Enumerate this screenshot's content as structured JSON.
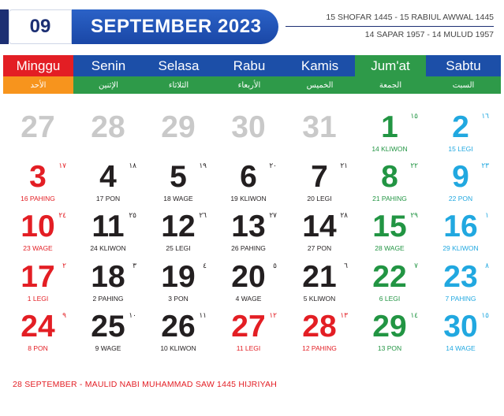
{
  "header": {
    "month_number": "09",
    "month_year": "SEPTEMBER 2023",
    "hijri_line1": "15 SHOFAR 1445 - 15 RABIUL AWWAL 1445",
    "hijri_line2": "14 SAPAR 1957 - 14 MULUD 1957"
  },
  "days": [
    {
      "name": "Minggu",
      "arabic": "الأحد",
      "color": "#e31e24",
      "arabic_bg": "#f7941d"
    },
    {
      "name": "Senin",
      "arabic": "الإثنين",
      "color": "#1c4fa8",
      "arabic_bg": "#2e9a49"
    },
    {
      "name": "Selasa",
      "arabic": "الثلاثاء",
      "color": "#1c4fa8",
      "arabic_bg": "#2e9a49"
    },
    {
      "name": "Rabu",
      "arabic": "الأربعاء",
      "color": "#1c4fa8",
      "arabic_bg": "#2e9a49"
    },
    {
      "name": "Kamis",
      "arabic": "الخميس",
      "color": "#1c4fa8",
      "arabic_bg": "#2e9a49"
    },
    {
      "name": "Jum'at",
      "arabic": "الجمعة",
      "color": "#2e9a49",
      "arabic_bg": "#2e9a49"
    },
    {
      "name": "Sabtu",
      "arabic": "السبت",
      "color": "#1c4fa8",
      "arabic_bg": "#2e9a49"
    }
  ],
  "colors": {
    "sunday": "#e31e24",
    "weekday": "#231f20",
    "friday": "#229543",
    "saturday": "#21a8e0",
    "faded": "#c9c9c9"
  },
  "weeks": [
    [
      {
        "day": "27",
        "faded": true
      },
      {
        "day": "28",
        "faded": true
      },
      {
        "day": "29",
        "faded": true
      },
      {
        "day": "30",
        "faded": true
      },
      {
        "day": "31",
        "faded": true
      },
      {
        "day": "1",
        "arabic": "١٥",
        "pasaran": "14 KLIWON"
      },
      {
        "day": "2",
        "arabic": "١٦",
        "pasaran": "15 LEGI"
      }
    ],
    [
      {
        "day": "3",
        "arabic": "١٧",
        "pasaran": "16 PAHING"
      },
      {
        "day": "4",
        "arabic": "١٨",
        "pasaran": "17 PON"
      },
      {
        "day": "5",
        "arabic": "١٩",
        "pasaran": "18 WAGE"
      },
      {
        "day": "6",
        "arabic": "٢٠",
        "pasaran": "19 KLIWON"
      },
      {
        "day": "7",
        "arabic": "٢١",
        "pasaran": "20 LEGI"
      },
      {
        "day": "8",
        "arabic": "٢٢",
        "pasaran": "21 PAHING"
      },
      {
        "day": "9",
        "arabic": "٢٣",
        "pasaran": "22 PON"
      }
    ],
    [
      {
        "day": "10",
        "arabic": "٢٤",
        "pasaran": "23 WAGE"
      },
      {
        "day": "11",
        "arabic": "٢٥",
        "pasaran": "24 KLIWON"
      },
      {
        "day": "12",
        "arabic": "٢٦",
        "pasaran": "25 LEGI"
      },
      {
        "day": "13",
        "arabic": "٢٧",
        "pasaran": "26 PAHING"
      },
      {
        "day": "14",
        "arabic": "٢٨",
        "pasaran": "27 PON"
      },
      {
        "day": "15",
        "arabic": "٢٩",
        "pasaran": "28 WAGE"
      },
      {
        "day": "16",
        "arabic": "١",
        "pasaran": "29 KLIWON"
      }
    ],
    [
      {
        "day": "17",
        "arabic": "٢",
        "pasaran": "1 LEGI"
      },
      {
        "day": "18",
        "arabic": "٣",
        "pasaran": "2 PAHING"
      },
      {
        "day": "19",
        "arabic": "٤",
        "pasaran": "3 PON"
      },
      {
        "day": "20",
        "arabic": "٥",
        "pasaran": "4 WAGE"
      },
      {
        "day": "21",
        "arabic": "٦",
        "pasaran": "5 KLIWON"
      },
      {
        "day": "22",
        "arabic": "٧",
        "pasaran": "6 LEGI"
      },
      {
        "day": "23",
        "arabic": "٨",
        "pasaran": "7 PAHING"
      }
    ],
    [
      {
        "day": "24",
        "arabic": "٩",
        "pasaran": "8 PON"
      },
      {
        "day": "25",
        "arabic": "١٠",
        "pasaran": "9 WAGE"
      },
      {
        "day": "26",
        "arabic": "١١",
        "pasaran": "10 KLIWON"
      },
      {
        "day": "27",
        "arabic": "١٢",
        "pasaran": "11 LEGI",
        "holiday": true
      },
      {
        "day": "28",
        "arabic": "١٣",
        "pasaran": "12 PAHING",
        "holiday": true
      },
      {
        "day": "29",
        "arabic": "١٤",
        "pasaran": "13 PON"
      },
      {
        "day": "30",
        "arabic": "١٥",
        "pasaran": "14 WAGE"
      }
    ]
  ],
  "footer_note": "28 SEPTEMBER - MAULID NABI MUHAMMAD SAW 1445 HIJRIYAH"
}
